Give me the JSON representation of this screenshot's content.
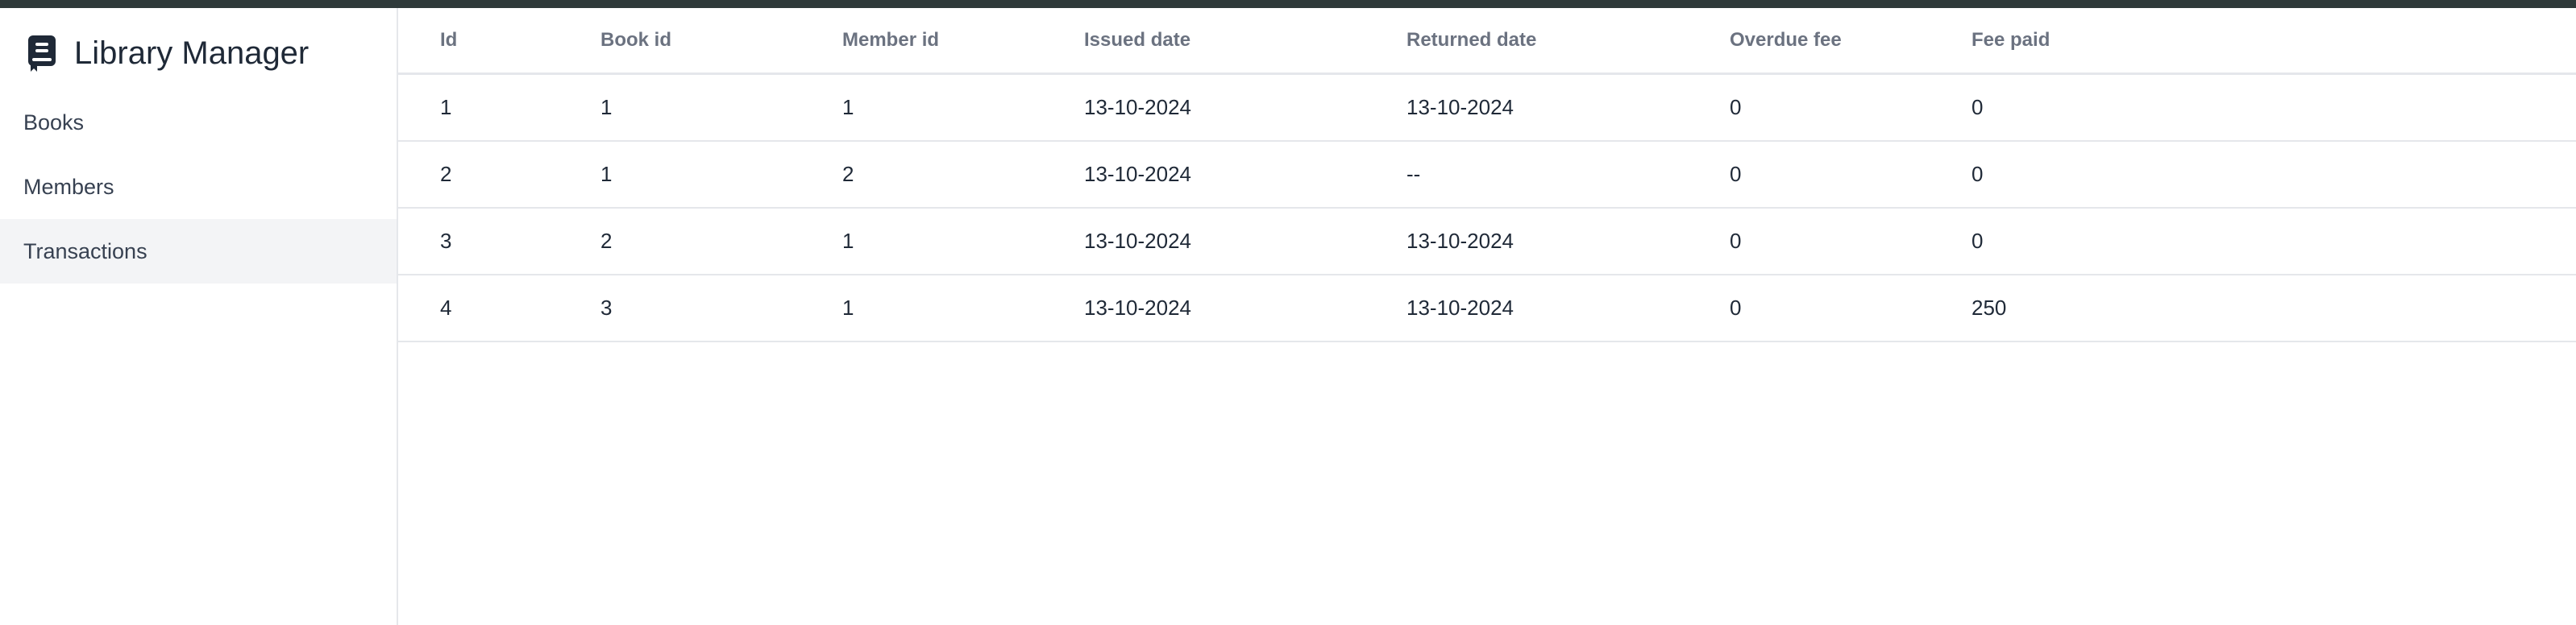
{
  "app": {
    "title": "Library Manager",
    "icon": "book-icon"
  },
  "sidebar": {
    "items": [
      {
        "label": "Books",
        "active": false
      },
      {
        "label": "Members",
        "active": false
      },
      {
        "label": "Transactions",
        "active": true
      }
    ]
  },
  "table": {
    "columns": [
      "Id",
      "Book id",
      "Member id",
      "Issued date",
      "Returned date",
      "Overdue fee",
      "Fee paid"
    ],
    "rows": [
      [
        "1",
        "1",
        "1",
        "13-10-2024",
        "13-10-2024",
        "0",
        "0"
      ],
      [
        "2",
        "1",
        "2",
        "13-10-2024",
        "--",
        "0",
        "0"
      ],
      [
        "3",
        "2",
        "1",
        "13-10-2024",
        "13-10-2024",
        "0",
        "0"
      ],
      [
        "4",
        "3",
        "1",
        "13-10-2024",
        "13-10-2024",
        "0",
        "250"
      ]
    ]
  },
  "colors": {
    "topbar": "#2f3a3a",
    "active_nav_bg": "#f3f4f6",
    "border": "#e5e7eb",
    "header_text": "#6b7280"
  }
}
